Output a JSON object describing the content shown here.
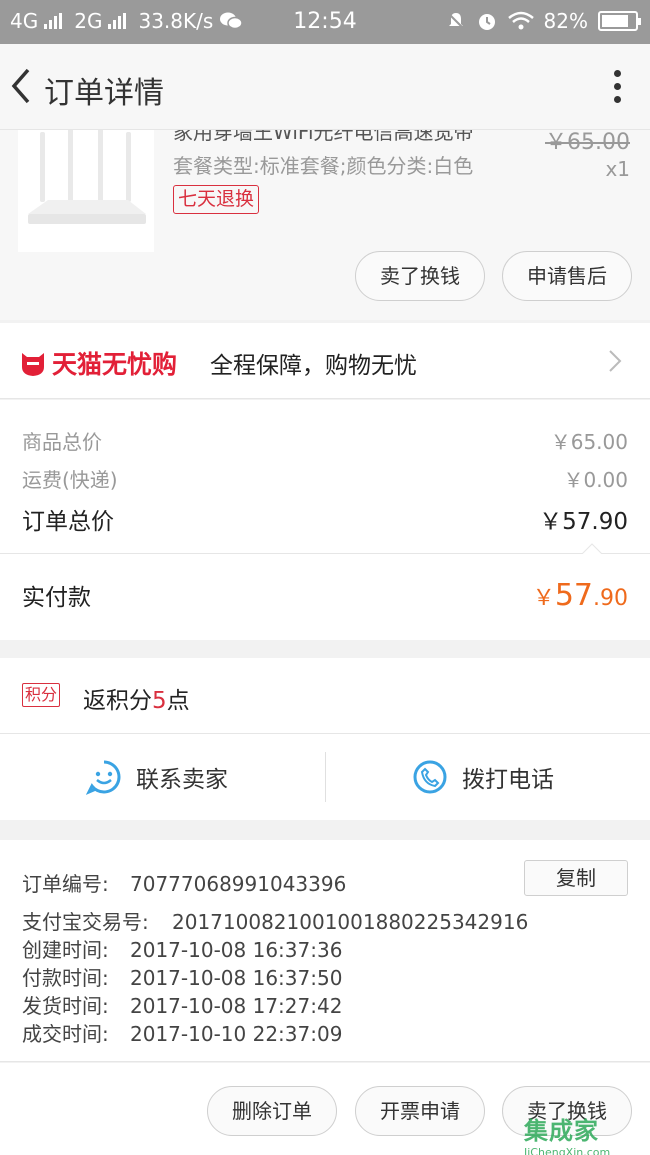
{
  "status_bar": {
    "network1": "4G",
    "network2": "2G",
    "speed": "33.8K/s",
    "time": "12:54",
    "battery": "82%",
    "battery_level": 0.82
  },
  "header": {
    "title": "订单详情"
  },
  "product": {
    "name": "家用穿墙王WiFi光纤电信高速宽带",
    "spec": "套餐类型:标准套餐;颜色分类:白色",
    "tag": "七天退换",
    "original_price": "￥65.00",
    "quantity": "x1"
  },
  "product_actions": {
    "sell_label": "卖了换钱",
    "aftersale_label": "申请售后"
  },
  "tmall_banner": {
    "brand": "天猫无忧购",
    "slogan": "全程保障，购物无忧"
  },
  "price": {
    "goods_label": "商品总价",
    "goods_value": "￥65.00",
    "shipping_label": "运费(快递)",
    "shipping_value": "￥0.00",
    "order_total_label": "订单总价",
    "order_total_value": "￥57.90",
    "paid_label": "实付款",
    "paid_currency": "￥",
    "paid_int": "57",
    "paid_dec": ".90"
  },
  "points": {
    "badge": "积分",
    "text_prefix": "返积分",
    "count": "5",
    "text_suffix": "点"
  },
  "contact": {
    "seller_label": "联系卖家",
    "phone_label": "拨打电话"
  },
  "order_info": {
    "order_no_label": "订单编号:",
    "order_no": "70777068991043396",
    "copy_label": "复制",
    "alipay_label": "支付宝交易号:",
    "alipay_no": "2017100821001001880225342916",
    "created_label": "创建时间:",
    "created": "2017-10-08 16:37:36",
    "paid_label": "付款时间:",
    "paid": "2017-10-08 16:37:50",
    "shipped_label": "发货时间:",
    "shipped": "2017-10-08 17:27:42",
    "completed_label": "成交时间:",
    "completed": "2017-10-10 22:37:09"
  },
  "bottom_bar": {
    "delete_label": "删除订单",
    "invoice_label": "开票申请",
    "sell_label": "卖了换钱"
  },
  "watermark": {
    "main": "集成家",
    "sub": "JiChengXin.com"
  },
  "colors": {
    "accent_red": "#d9303f",
    "price_orange": "#ef6a1c",
    "contact_blue": "#3aa3e3"
  }
}
